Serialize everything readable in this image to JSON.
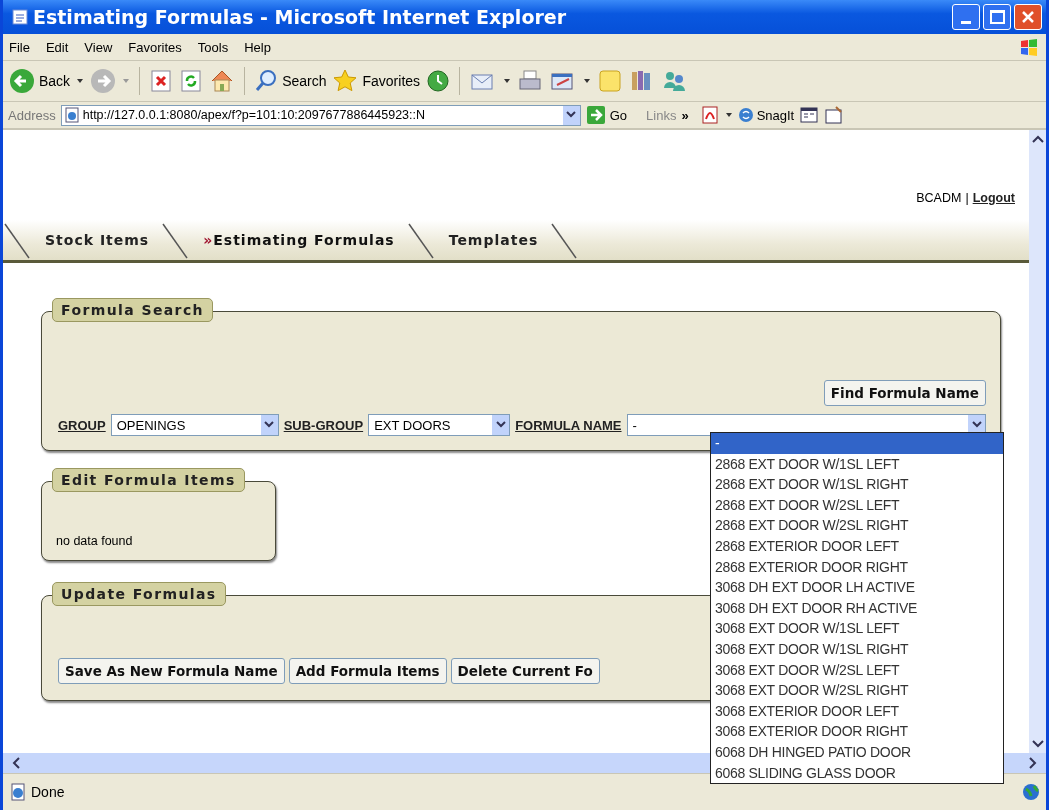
{
  "window": {
    "title": "Estimating Formulas - Microsoft Internet Explorer"
  },
  "menu_bar": [
    "File",
    "Edit",
    "View",
    "Favorites",
    "Tools",
    "Help"
  ],
  "toolbar": {
    "back": "Back",
    "search": "Search",
    "favorites": "Favorites"
  },
  "address_bar": {
    "label": "Address",
    "url": "http://127.0.0.1:8080/apex/f?p=101:10:2097677886445923::N",
    "go": "Go",
    "links": "Links",
    "more": "»",
    "snagit": "SnagIt"
  },
  "user_bar": {
    "user": "BCADM",
    "separator": "|",
    "logout": "Logout"
  },
  "tabs": {
    "current_marker": "»",
    "items": [
      {
        "label": "Stock Items",
        "selected": false
      },
      {
        "label": "Estimating Formulas",
        "selected": true
      },
      {
        "label": "Templates",
        "selected": false
      }
    ]
  },
  "formula_search": {
    "title": "Formula Search",
    "find_button": "Find Formula Name",
    "fields": [
      {
        "label": "GROUP",
        "value": "OPENINGS"
      },
      {
        "label": "SUB-GROUP",
        "value": "EXT DOORS"
      },
      {
        "label": "FORMULA NAME",
        "value": "-"
      }
    ]
  },
  "edit_formula_items": {
    "title": "Edit Formula Items",
    "message": "no data found"
  },
  "update_formulas": {
    "title": "Update Formulas",
    "buttons": [
      "Save As New Formula Name",
      "Add Formula Items",
      "Delete Current Fo"
    ]
  },
  "formula_name_dropdown": {
    "options": [
      {
        "label": "-",
        "selected": true
      },
      {
        "label": "2868 EXT DOOR W/1SL LEFT",
        "selected": false
      },
      {
        "label": "2868 EXT DOOR W/1SL RIGHT",
        "selected": false
      },
      {
        "label": "2868 EXT DOOR W/2SL LEFT",
        "selected": false
      },
      {
        "label": "2868 EXT DOOR W/2SL RIGHT",
        "selected": false
      },
      {
        "label": "2868 EXTERIOR DOOR LEFT",
        "selected": false
      },
      {
        "label": "2868 EXTERIOR DOOR RIGHT",
        "selected": false
      },
      {
        "label": "3068 DH EXT DOOR LH ACTIVE",
        "selected": false
      },
      {
        "label": "3068 DH EXT DOOR RH ACTIVE",
        "selected": false
      },
      {
        "label": "3068 EXT DOOR W/1SL LEFT",
        "selected": false
      },
      {
        "label": "3068 EXT DOOR W/1SL RIGHT",
        "selected": false
      },
      {
        "label": "3068 EXT DOOR W/2SL LEFT",
        "selected": false
      },
      {
        "label": "3068 EXT DOOR W/2SL RIGHT",
        "selected": false
      },
      {
        "label": "3068 EXTERIOR DOOR LEFT",
        "selected": false
      },
      {
        "label": "3068 EXTERIOR DOOR RIGHT",
        "selected": false
      },
      {
        "label": "6068 DH HINGED PATIO DOOR",
        "selected": false
      },
      {
        "label": "6068 SLIDING GLASS DOOR",
        "selected": false
      }
    ]
  },
  "status_bar": {
    "text": "Done"
  }
}
